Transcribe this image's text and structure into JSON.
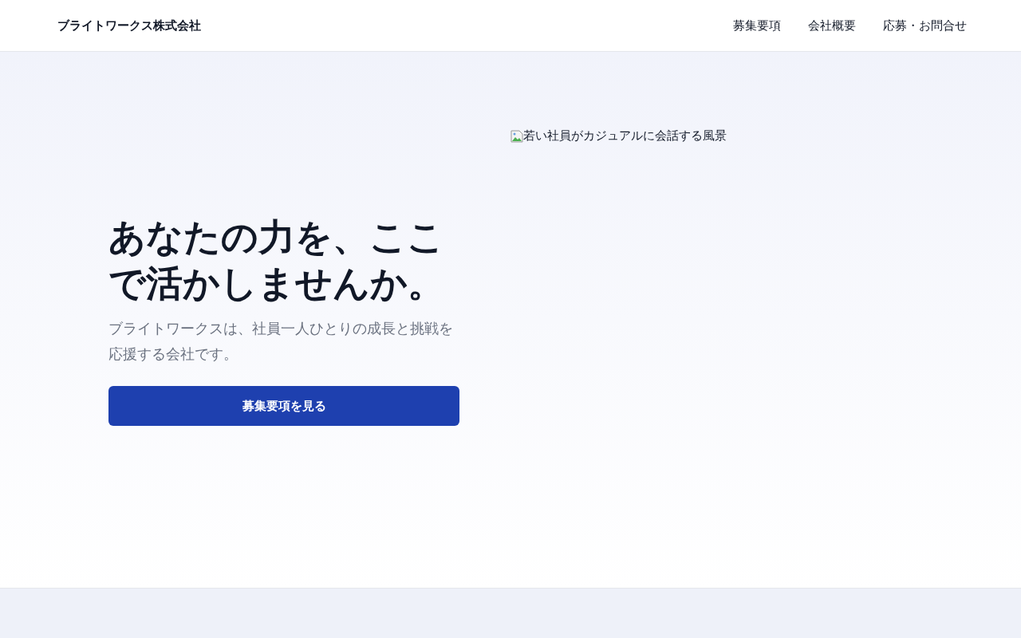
{
  "header": {
    "logo": "ブライトワークス株式会社",
    "nav": [
      {
        "label": "募集要項"
      },
      {
        "label": "会社概要"
      },
      {
        "label": "応募・お問合せ"
      }
    ]
  },
  "hero": {
    "heading": "あなたの力を、ここで活かしませんか。",
    "lead": "ブライトワークスは、社員一人ひとりの成長と挑戦を応援する会社です。",
    "button": "募集要項を見る",
    "image_alt": "若い社員がカジュアルに会話する風景"
  }
}
